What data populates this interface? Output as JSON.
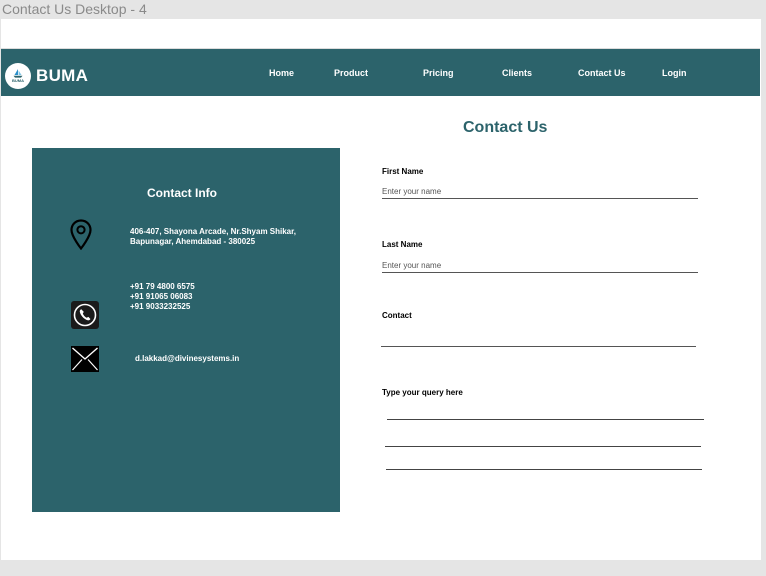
{
  "frame": {
    "label": "Contact Us Desktop - 4"
  },
  "brand": {
    "name": "BUMA",
    "logo_text": "BUMA",
    "color": "#2c636b"
  },
  "nav": {
    "items": [
      {
        "label": "Home"
      },
      {
        "label": "Product"
      },
      {
        "label": "Pricing"
      },
      {
        "label": "Clients"
      },
      {
        "label": "Contact Us"
      },
      {
        "label": "Login"
      }
    ]
  },
  "page": {
    "title": "Contact Us"
  },
  "contact_info": {
    "title": "Contact Info",
    "address": {
      "icon": "map-pin-icon",
      "lines": [
        "406-407, Shayona Arcade, Nr.Shyam Shikar,",
        "Bapunagar, Ahemdabad - 380025"
      ]
    },
    "phone": {
      "icon": "phone-icon",
      "lines": [
        "+91 79 4800 6575",
        "+91 91065 06083",
        "+91 9033232525"
      ]
    },
    "email": {
      "icon": "envelope-icon",
      "value": "d.lakkad@divinesystems.in"
    }
  },
  "form": {
    "first_name": {
      "label": "First Name",
      "placeholder": "Enter your name",
      "value": ""
    },
    "last_name": {
      "label": "Last Name",
      "placeholder": "Enter your name",
      "value": ""
    },
    "contact": {
      "label": "Contact",
      "placeholder": "",
      "value": ""
    },
    "query": {
      "label": "Type your query here",
      "value": ""
    }
  },
  "colors": {
    "primary": "#2c636b",
    "background": "#ffffff",
    "frame_bg": "#e5e5e5"
  }
}
